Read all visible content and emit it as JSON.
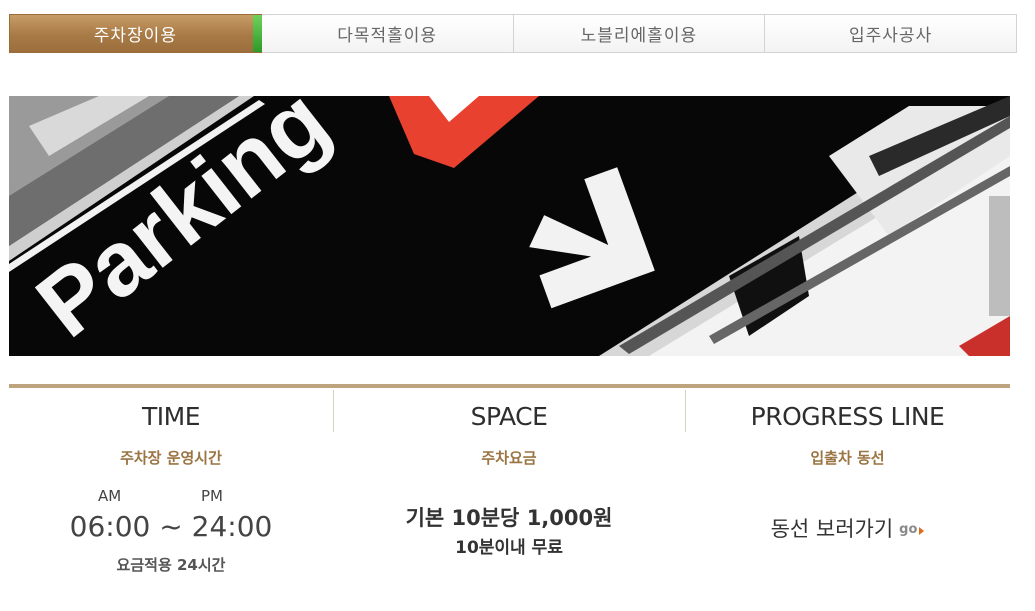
{
  "tabs": [
    {
      "label": "주차장이용",
      "active": true
    },
    {
      "label": "다목적홀이용",
      "active": false
    },
    {
      "label": "노블리에홀이용",
      "active": false
    },
    {
      "label": "입주사공사",
      "active": false
    }
  ],
  "banner": {
    "sign_text": "Parking",
    "arrow_icon": "arrow-down-icon"
  },
  "info": {
    "time": {
      "title": "TIME",
      "subtitle": "주차장 운영시간",
      "am": "AM",
      "pm": "PM",
      "range": "06:00 ~ 24:00",
      "note": "요금적용 24시간"
    },
    "space": {
      "title": "SPACE",
      "subtitle": "주차요금",
      "fee": "기본 10분당 1,000원",
      "note": "10분이내 무료"
    },
    "progress": {
      "title": "PROGRESS LINE",
      "subtitle": "입출차 동선",
      "link": "동선 보러가기",
      "go": "go"
    }
  },
  "colors": {
    "active_tab": "#a87a46",
    "accent_green": "#3aa833",
    "subtitle": "#9a7442",
    "divider": "#bda47f",
    "sign_red": "#e8412f"
  }
}
